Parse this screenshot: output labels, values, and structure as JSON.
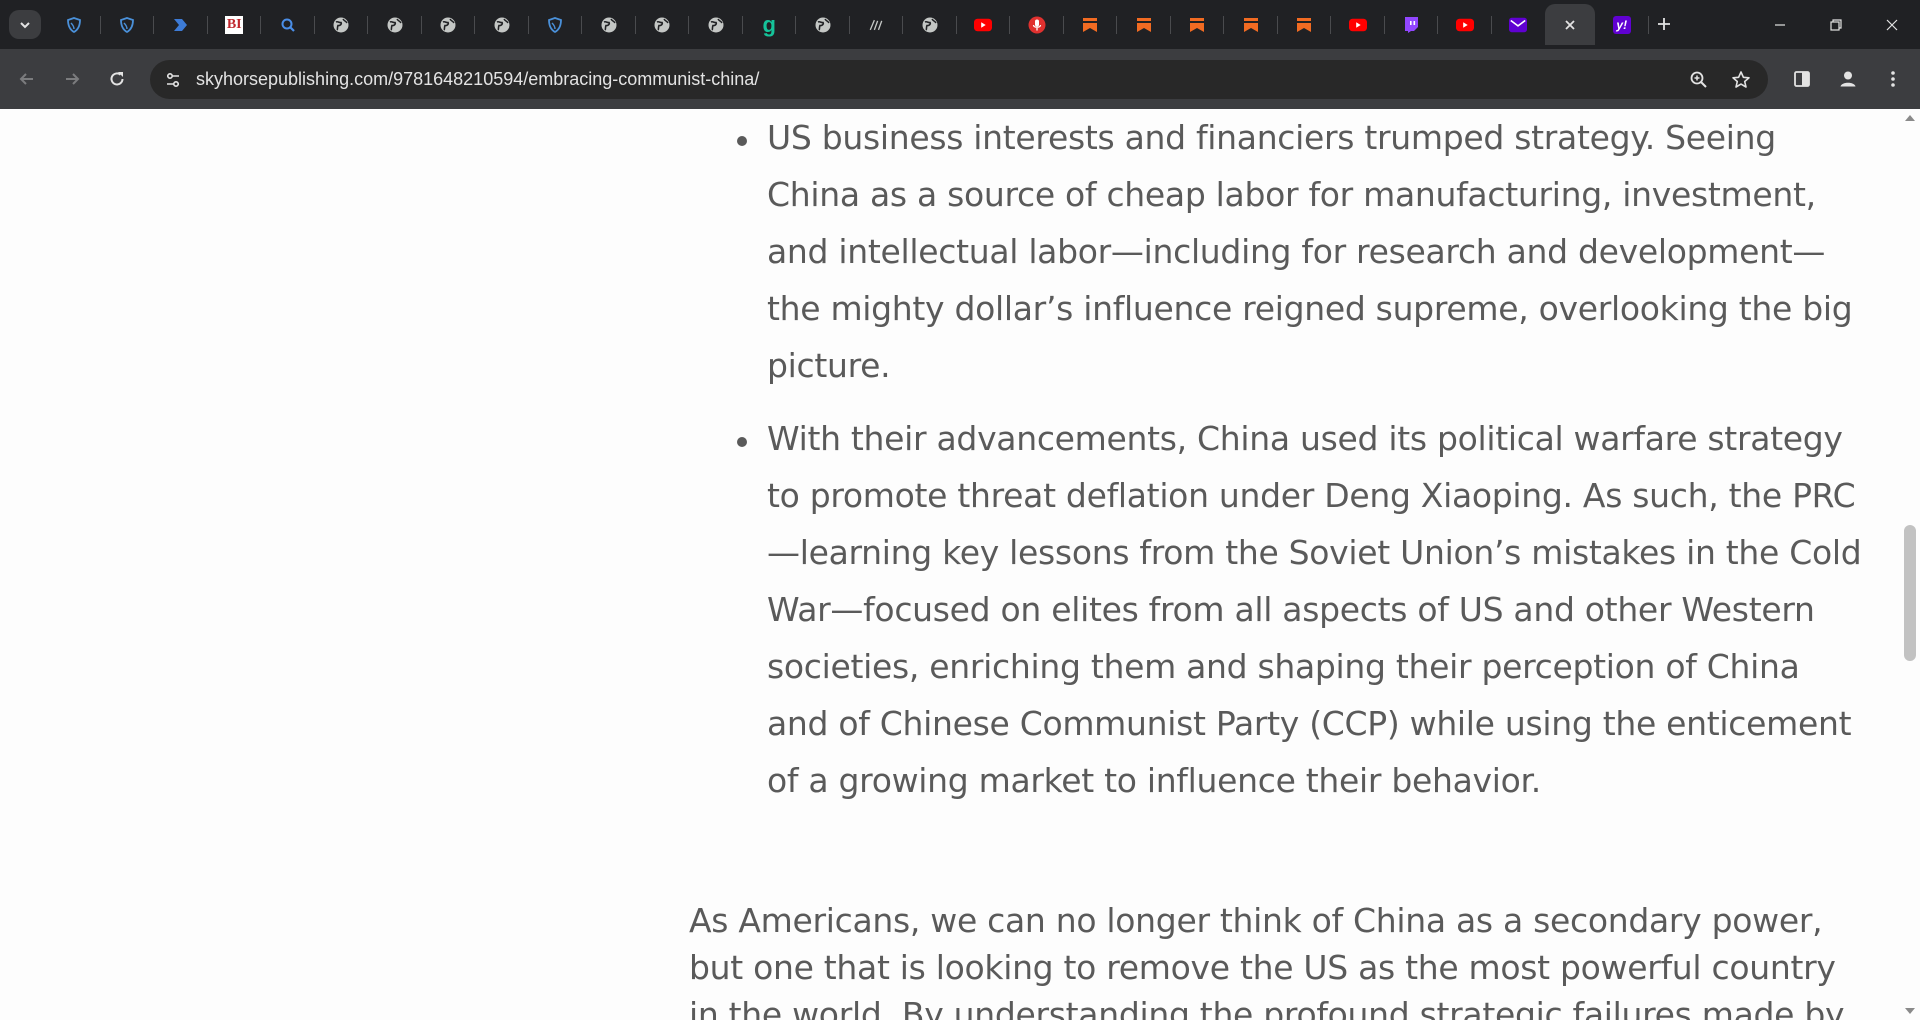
{
  "browser": {
    "url": "skyhorsepublishing.com/9781648210594/embracing-communist-china/",
    "tabs": [
      {
        "icon": "shield-icon",
        "color": "#4a90d9"
      },
      {
        "icon": "shield-icon",
        "color": "#4a90d9"
      },
      {
        "icon": "chevron-tag-icon",
        "color": "#3d7bd6"
      },
      {
        "icon": "bi-logo-icon",
        "label": "BI",
        "color": "#c0272d"
      },
      {
        "icon": "search-icon",
        "color": "#4a8ee8"
      },
      {
        "icon": "globe-icon",
        "color": "#c4c7c5"
      },
      {
        "icon": "globe-icon",
        "color": "#c4c7c5"
      },
      {
        "icon": "globe-icon",
        "color": "#c4c7c5"
      },
      {
        "icon": "globe-icon",
        "color": "#c4c7c5"
      },
      {
        "icon": "shield-icon",
        "color": "#4a90d9"
      },
      {
        "icon": "globe-icon",
        "color": "#c4c7c5"
      },
      {
        "icon": "globe-icon",
        "color": "#c4c7c5"
      },
      {
        "icon": "globe-icon",
        "color": "#c4c7c5"
      },
      {
        "icon": "g-logo-icon",
        "label": "g",
        "color": "#15c39a"
      },
      {
        "icon": "globe-icon",
        "color": "#c4c7c5"
      },
      {
        "icon": "script-logo-icon",
        "color": "#c4c7c5"
      },
      {
        "icon": "globe-icon",
        "color": "#c4c7c5"
      },
      {
        "icon": "youtube-icon",
        "color": "#ff0000"
      },
      {
        "icon": "microphone-icon",
        "color": "#e0312f"
      },
      {
        "icon": "bookmark-icon",
        "color": "#f26b22"
      },
      {
        "icon": "bookmark-icon",
        "color": "#f26b22"
      },
      {
        "icon": "bookmark-icon",
        "color": "#f26b22"
      },
      {
        "icon": "bookmark-icon",
        "color": "#f26b22"
      },
      {
        "icon": "bookmark-icon",
        "color": "#f26b22"
      },
      {
        "icon": "youtube-icon",
        "color": "#ff0000"
      },
      {
        "icon": "twitch-icon",
        "color": "#9146ff"
      },
      {
        "icon": "youtube-icon",
        "color": "#ff0000"
      },
      {
        "icon": "mail-icon",
        "color": "#6001d2"
      },
      {
        "icon": "close-icon",
        "color": "#e3e3e3",
        "active": true
      },
      {
        "icon": "yahoo-icon",
        "label": "y!",
        "color": "#6001d2"
      }
    ]
  },
  "article": {
    "bullets": [
      "US business interests and financiers trumped strategy. Seeing China as a source of cheap labor for manufacturing, investment, and intellectual labor—including for research and development—the mighty dollar’s influence reigned supreme, overlooking the big picture.",
      "With their advancements, China used its political warfare strategy to promote threat deflation under Deng Xiaoping. As such, the PRC—learning key lessons from the Soviet Union’s mistakes in the Cold War—focused on elites from all aspects of US and other Western societies, enriching them and shaping their perception of China and of Chinese Communist Party (CCP) while using the enticement of a growing market to influence their behavior."
    ],
    "paragraph": "As Americans, we can no longer think of China as a secondary power, but one that is looking to remove the US as the most powerful country in the world. By understanding the profound strategic failures made by"
  }
}
